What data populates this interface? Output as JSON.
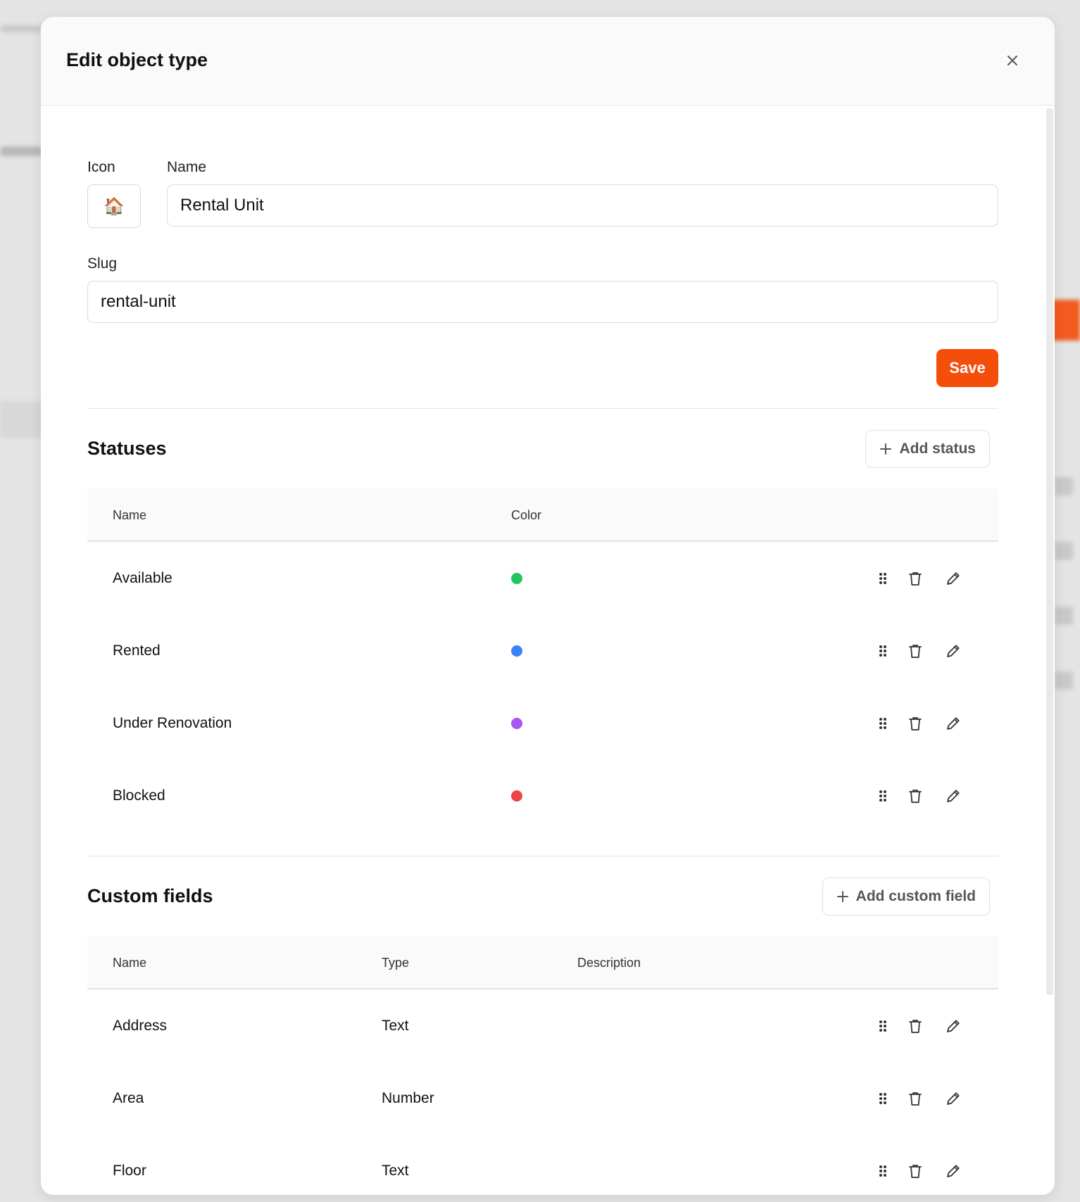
{
  "modal": {
    "title": "Edit object type"
  },
  "form": {
    "icon_label": "Icon",
    "icon_value": "🏠",
    "name_label": "Name",
    "name_value": "Rental Unit",
    "slug_label": "Slug",
    "slug_value": "rental-unit",
    "save_label": "Save"
  },
  "statuses": {
    "title": "Statuses",
    "add_label": "Add status",
    "columns": [
      "Name",
      "Color"
    ],
    "rows": [
      {
        "name": "Available",
        "color": "#22c55e"
      },
      {
        "name": "Rented",
        "color": "#3b82f6"
      },
      {
        "name": "Under Renovation",
        "color": "#a855f7"
      },
      {
        "name": "Blocked",
        "color": "#ef4444"
      }
    ]
  },
  "custom_fields": {
    "title": "Custom fields",
    "add_label": "Add custom field",
    "columns": [
      "Name",
      "Type",
      "Description"
    ],
    "rows": [
      {
        "name": "Address",
        "type": "Text",
        "description": ""
      },
      {
        "name": "Area",
        "type": "Number",
        "description": ""
      },
      {
        "name": "Floor",
        "type": "Text",
        "description": ""
      }
    ]
  },
  "colors": {
    "accent": "#f44e0b"
  }
}
